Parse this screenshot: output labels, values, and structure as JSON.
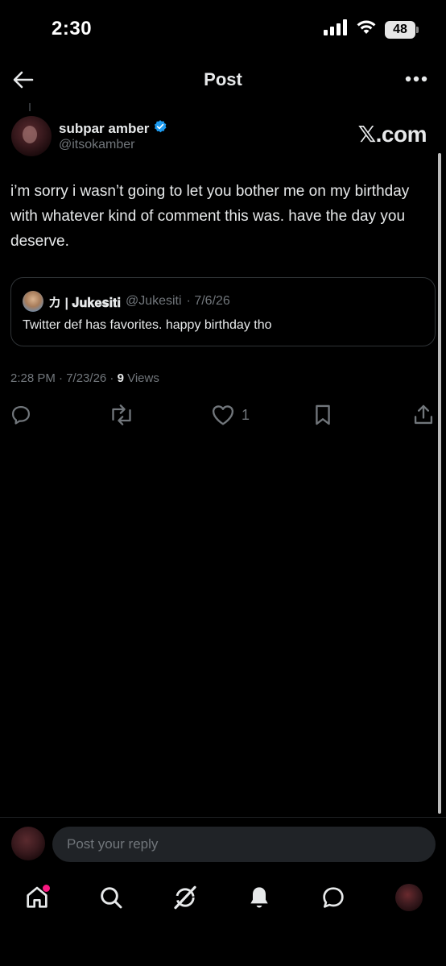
{
  "status_bar": {
    "time": "2:30",
    "battery": "48"
  },
  "header": {
    "title": "Post"
  },
  "post": {
    "author_name": "subpar amber",
    "author_handle": "@itsokamber",
    "watermark": "𝕏.com",
    "text": "i’m sorry i wasn’t going to let you bother me on my birthday with whatever kind of comment this was. have the day you deserve.",
    "quote": {
      "author_name": "カ | 𝐉𝐮𝐤𝐞𝐬𝐢𝐭𝐢",
      "author_handle": "@Jukesiti",
      "date": "· 7/6/26",
      "text": "Twitter def has favorites. happy birthday tho"
    },
    "time": "2:28 PM",
    "date": "· 7/23/26 ·",
    "views_count": "9",
    "views_label": "Views",
    "like_count": "1"
  },
  "reply": {
    "placeholder": "Post your reply"
  },
  "colors": {
    "background": "#000000",
    "text": "#e7e9ea",
    "muted": "#71767b",
    "verified": "#1d9bf0",
    "notification": "#f91880"
  }
}
